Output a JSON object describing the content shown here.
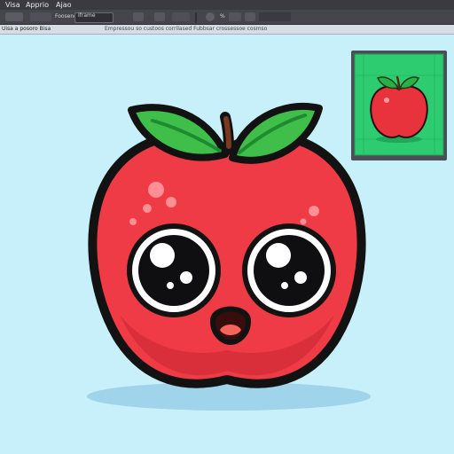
{
  "menu": {
    "items": [
      {
        "label": "Visa"
      },
      {
        "label": "Apprio"
      },
      {
        "label": "Ajao"
      }
    ]
  },
  "toolbar": {
    "field_text": "Iframe",
    "second_text": "Foosenoy",
    "percent_label": "%"
  },
  "hint_bar": {
    "left_text": "Uisa a posoro Bisa",
    "center_text": "Empressou so custoos corrilased Fubbsar crossessoe cosmso"
  },
  "canvas": {
    "background": "#c7f0fb",
    "subject_icon": "apple-character"
  },
  "preview": {
    "background": "#2ecc71",
    "subject_icon": "apple-thumbnail-icon"
  },
  "colors": {
    "apple_red": "#ef3b45",
    "leaf_green": "#3fbf4a",
    "outline": "#121212"
  }
}
